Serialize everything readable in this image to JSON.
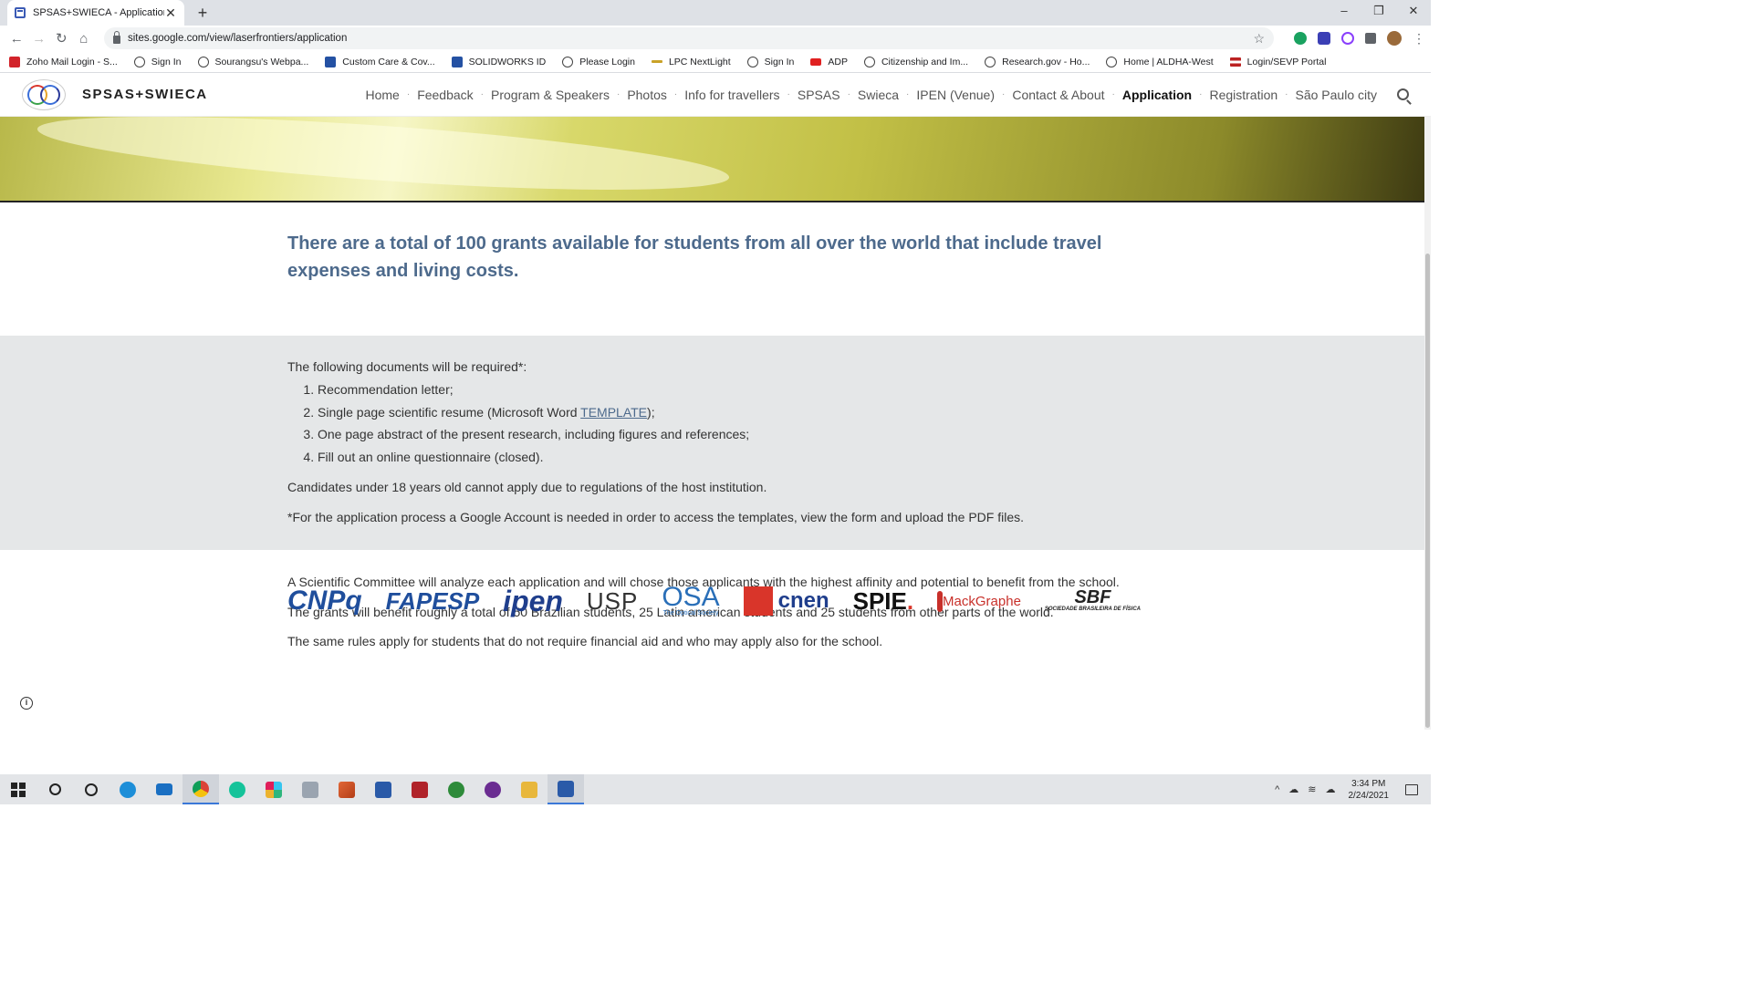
{
  "browser": {
    "tab_title": "SPSAS+SWIECA - Application",
    "tab_close": "✕",
    "new_tab": "+",
    "url": "sites.google.com/view/laserfrontiers/application",
    "window_controls": [
      "–",
      "❐",
      "✕"
    ],
    "bookmarks": [
      {
        "label": "Zoho Mail Login - S...",
        "icon": "zoho-icon"
      },
      {
        "label": "Sign In",
        "icon": "globe-icon"
      },
      {
        "label": "Sourangsu's Webpa...",
        "icon": "globe-icon"
      },
      {
        "label": "Custom Care & Cov...",
        "icon": "castle-icon"
      },
      {
        "label": "SOLIDWORKS ID",
        "icon": "solidworks-icon"
      },
      {
        "label": "Please Login",
        "icon": "globe-icon"
      },
      {
        "label": "LPC NextLight",
        "icon": "lpc-icon"
      },
      {
        "label": "Sign In",
        "icon": "globe-icon"
      },
      {
        "label": "ADP",
        "icon": "adp-icon"
      },
      {
        "label": "Citizenship and Im...",
        "icon": "seal-icon"
      },
      {
        "label": "Research.gov - Ho...",
        "icon": "globe-icon"
      },
      {
        "label": "Home | ALDHA-West",
        "icon": "house-icon"
      },
      {
        "label": "Login/SEVP Portal",
        "icon": "us-flag-icon"
      }
    ]
  },
  "site": {
    "brand": "SPSAS+SWIECA",
    "nav": [
      {
        "label": "Home",
        "active": false
      },
      {
        "label": "Feedback",
        "active": false
      },
      {
        "label": "Program & Speakers",
        "active": false
      },
      {
        "label": "Photos",
        "active": false
      },
      {
        "label": "Info for travellers",
        "active": false
      },
      {
        "label": "SPSAS",
        "active": false
      },
      {
        "label": "Swieca",
        "active": false
      },
      {
        "label": "IPEN (Venue)",
        "active": false
      },
      {
        "label": "Contact & About",
        "active": false
      },
      {
        "label": "Application",
        "active": true
      },
      {
        "label": "Registration",
        "active": false
      },
      {
        "label": "São Paulo city",
        "active": false
      }
    ],
    "headline": "There are a total of 100 grants available for students from all over the world that include travel expenses and living costs.",
    "documents_intro": "The following documents will be required*:",
    "documents": [
      "Recommendation letter;",
      "Single page scientific resume (Microsoft Word ",
      "One page abstract of the present research, including figures and references;",
      "Fill out an online questionnaire (closed)."
    ],
    "template_link": "TEMPLATE",
    "template_suffix": ");",
    "age_note": "Candidates under 18 years old cannot apply due to regulations of the host institution.",
    "account_note": "*For the application process a Google Account is needed in order to access the templates, view the form and upload the PDF files.",
    "committee": "A Scientific Committee will analyze each application and will chose those applicants with the highest affinity and potential to benefit from the school.",
    "grants_split": "The grants will benefit roughly a total of 50 Brazilian students, 25 Latin american students and 25 students from other parts of the world.",
    "same_rules": "The same rules apply for students that do not require financial aid and who may apply also for the school.",
    "sponsors": {
      "cnpq": "CNPq",
      "fapesp": "FAPESP",
      "ipen": "ipen",
      "usp": "USP",
      "osa": "OSA",
      "osa_sub": "The Optical Society",
      "cnen": "cnen",
      "spie": "SPIE",
      "spie_dot": ".",
      "mack": "MackGraphe",
      "sbf": "SBF",
      "sbf_sub": "SOCIEDADE BRASILEIRA DE FÍSICA"
    }
  },
  "taskbar": {
    "time": "3:34 PM",
    "date": "2/24/2021"
  },
  "colors": {
    "headline": "#4d6a8c",
    "grey_section": "#e5e7e8",
    "link": "#4d6a8c"
  }
}
